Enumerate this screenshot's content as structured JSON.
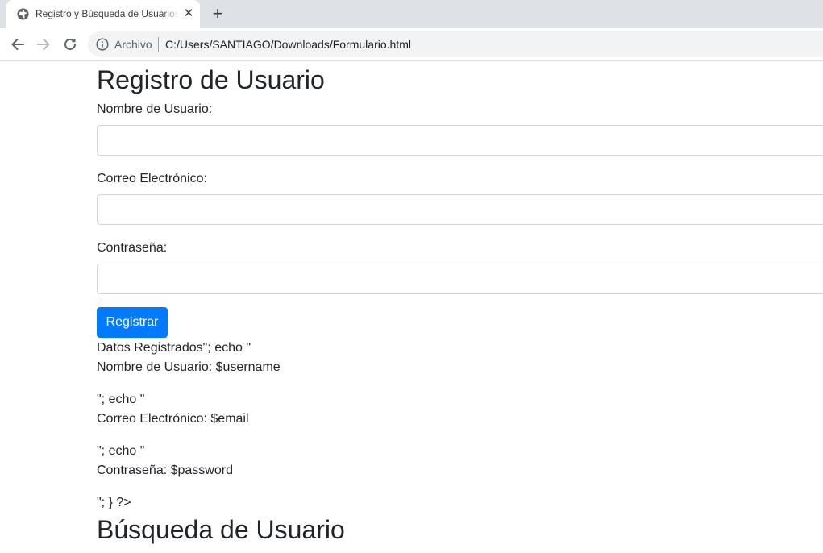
{
  "browser": {
    "tab_title": "Registro y Búsqueda de Usuarios",
    "tab_close_glyph": "✕",
    "new_tab_glyph": "+",
    "omnibox_chip": "Archivo",
    "url": "C:/Users/SANTIAGO/Downloads/Formulario.html",
    "icons": [
      "globe-icon",
      "close-icon",
      "plus-icon",
      "back-arrow-icon",
      "forward-arrow-icon",
      "reload-icon",
      "info-icon"
    ]
  },
  "page": {
    "registration_heading": "Registro de Usuario",
    "fields": [
      {
        "label": "Nombre de Usuario:",
        "value": ""
      },
      {
        "label": "Correo Electrónico:",
        "value": ""
      },
      {
        "label": "Contraseña:",
        "value": ""
      }
    ],
    "submit_label": "Registrar",
    "raw_output_lines": [
      "Datos Registrados\"; echo \"",
      "Nombre de Usuario: $username",
      "\"; echo \"",
      "Correo Electrónico: $email",
      "\"; echo \"",
      "Contraseña: $password",
      "\"; } ?>"
    ],
    "search_heading": "Búsqueda de Usuario"
  },
  "colors": {
    "primary_button": "#007bff",
    "text": "#212529",
    "input_border": "#ced4da",
    "tabstrip": "#dee1e6"
  }
}
